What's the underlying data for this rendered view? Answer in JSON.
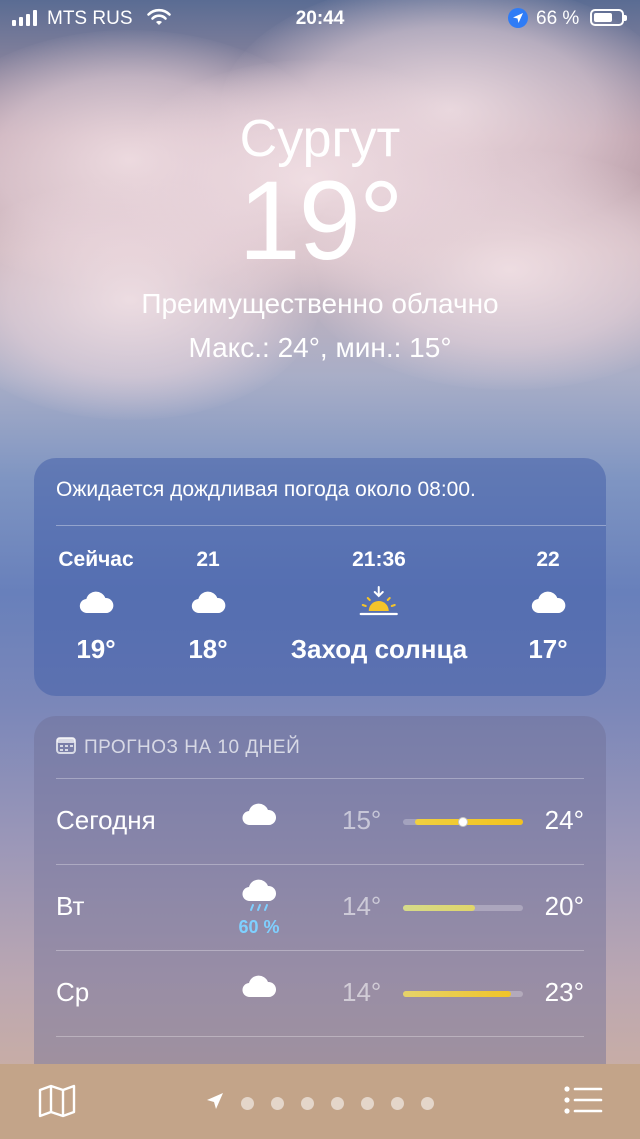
{
  "status_bar": {
    "carrier": "MTS RUS",
    "time": "20:44",
    "battery_percent": "66 %",
    "battery_level": 0.66
  },
  "hero": {
    "city": "Сургут",
    "temperature": "19°",
    "condition": "Преимущественно облачно",
    "hi_lo": "Макс.: 24°, мин.: 15°"
  },
  "hourly": {
    "note": "Ожидается дождливая погода около 08:00.",
    "items": [
      {
        "time": "Сейчас",
        "icon": "cloud-icon",
        "value": "19°"
      },
      {
        "time": "21",
        "icon": "cloud-icon",
        "value": "18°"
      },
      {
        "time": "21:36",
        "icon": "sunset-icon",
        "value": "Заход солнца"
      },
      {
        "time": "22",
        "icon": "cloud-icon",
        "value": "17°"
      }
    ]
  },
  "daily": {
    "header": "ПРОГНОЗ НА 10 ДНЕЙ",
    "header_icon": "calendar-icon",
    "week_min": 14,
    "week_max": 24,
    "current_temp": 19,
    "days": [
      {
        "day": "Сегодня",
        "icon": "cloud-icon",
        "precip": "",
        "lo": "15°",
        "hi": "24°",
        "lo_val": 15,
        "hi_val": 24,
        "color_from": "#f0d040",
        "color_to": "#f2c21e"
      },
      {
        "day": "Вт",
        "icon": "cloud-rain-icon",
        "precip": "60 %",
        "lo": "14°",
        "hi": "20°",
        "lo_val": 14,
        "hi_val": 20,
        "color_from": "#d6db8a",
        "color_to": "#e0d66a"
      },
      {
        "day": "Ср",
        "icon": "cloud-icon",
        "precip": "",
        "lo": "14°",
        "hi": "23°",
        "lo_val": 14,
        "hi_val": 23,
        "color_from": "#e6d36a",
        "color_to": "#f0c428"
      }
    ]
  },
  "colors": {
    "accent_location": "#2f7cf6",
    "precip_text": "#7fd0ff",
    "tabbar": "#c3a489"
  },
  "tabbar": {
    "map_icon": "map-icon",
    "location_icon": "location-arrow-icon",
    "list_icon": "list-icon",
    "page_count": 7
  }
}
